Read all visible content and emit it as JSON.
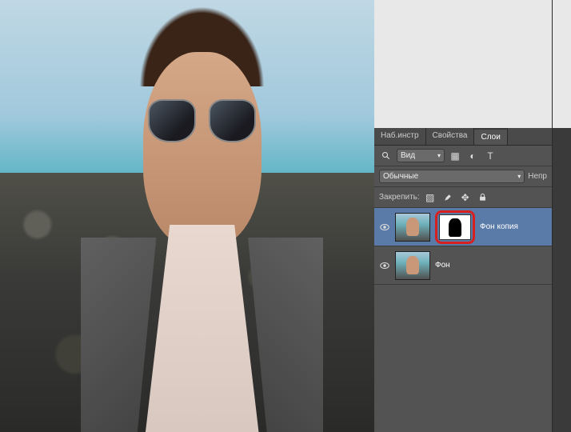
{
  "tabs": {
    "navigator": "Наб.инстр",
    "properties": "Свойства",
    "layers": "Слои"
  },
  "toolbar": {
    "view_label": "Вид"
  },
  "blend": {
    "mode": "Обычные",
    "opacity_label": "Непр"
  },
  "lock": {
    "label": "Закрепить:"
  },
  "layers": [
    {
      "name": "Фон копия",
      "visible": true,
      "has_mask": true,
      "selected": true
    },
    {
      "name": "Фон",
      "visible": true,
      "has_mask": false,
      "selected": false
    }
  ]
}
